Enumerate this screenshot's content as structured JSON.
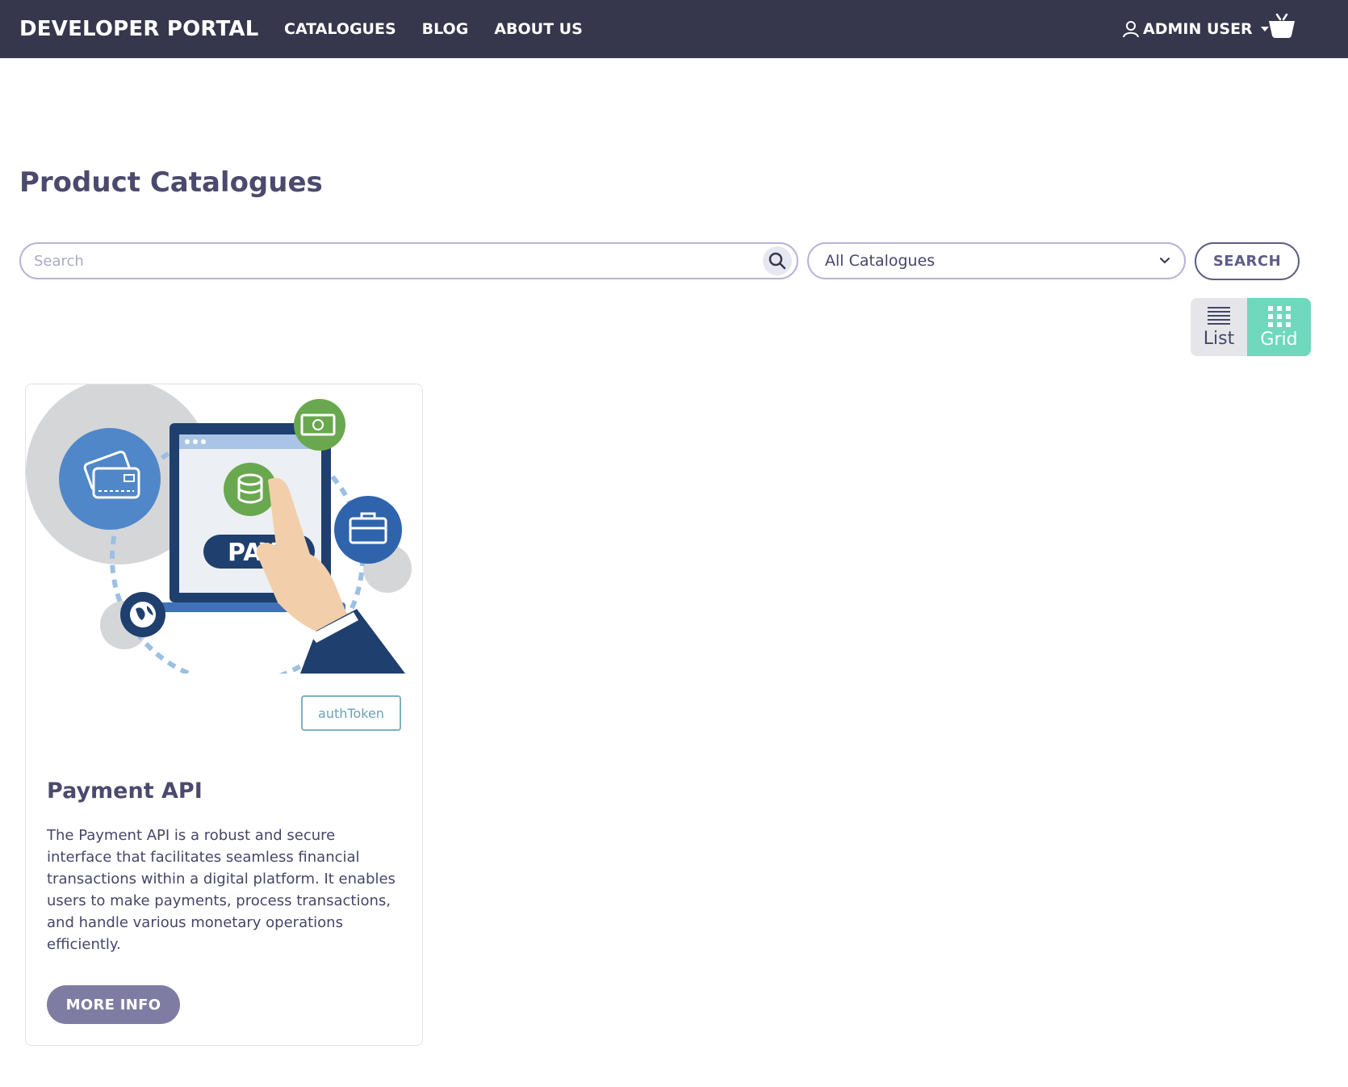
{
  "header": {
    "brand": "DEVELOPER PORTAL",
    "nav": [
      {
        "label": "CATALOGUES"
      },
      {
        "label": "BLOG"
      },
      {
        "label": "ABOUT US"
      }
    ],
    "user_label": "ADMIN USER",
    "icons": {
      "user": "user-icon",
      "basket": "basket-icon",
      "caret": "caret-down-icon"
    }
  },
  "page": {
    "title": "Product Catalogues"
  },
  "filters": {
    "search_placeholder": "Search",
    "search_value": "",
    "catalogue_select_value": "All Catalogues",
    "search_button_label": "SEARCH"
  },
  "view_toggle": {
    "list_label": "List",
    "grid_label": "Grid",
    "active": "Grid"
  },
  "cards": [
    {
      "tag": "authToken",
      "title": "Payment API",
      "description": "The Payment API is a robust and secure interface that facilitates seamless financial transactions within a digital platform. It enables users to make payments, process transactions, and handle various monetary operations efficiently.",
      "button_label": "MORE INFO",
      "image_text": "PAY"
    }
  ],
  "colors": {
    "nav_bg": "#36364c",
    "accent": "#6fd8bd",
    "primary_text": "#4b4a6e",
    "button_bg": "#7f7ca3",
    "border": "#b7b3d9"
  }
}
